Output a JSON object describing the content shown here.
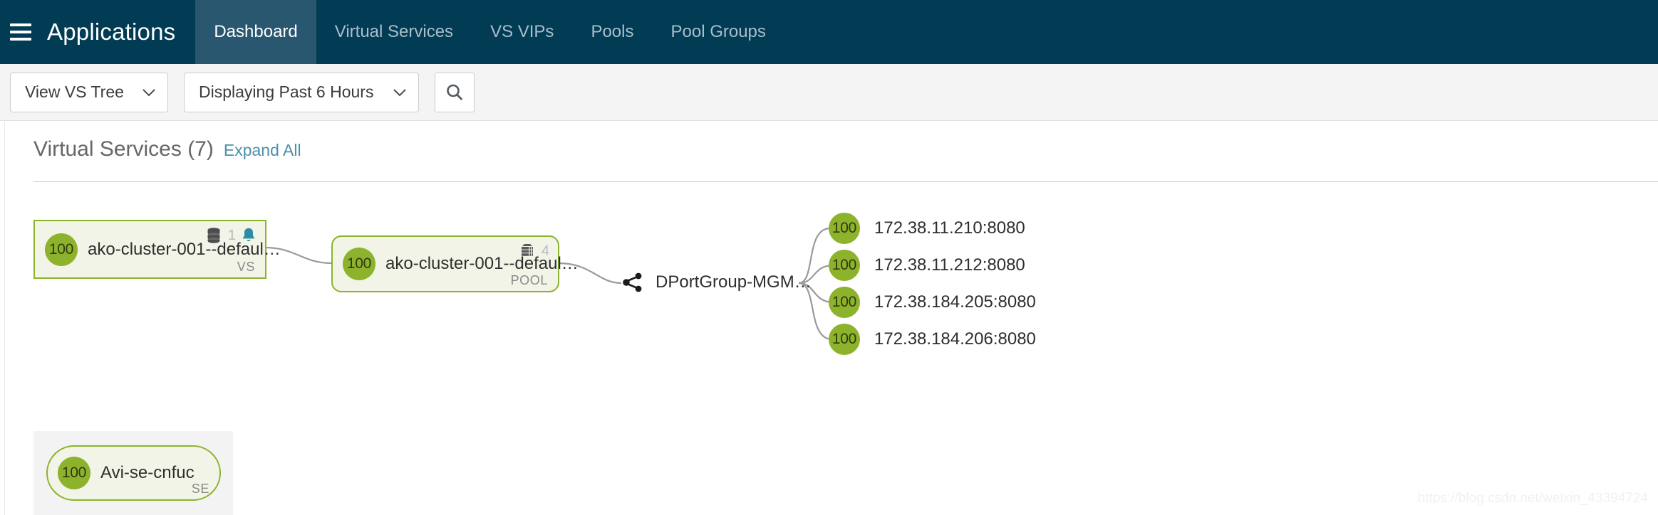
{
  "topnav": {
    "menu_icon": "hamburger-icon",
    "brand": "Applications",
    "tabs": [
      {
        "label": "Dashboard",
        "active": true
      },
      {
        "label": "Virtual Services",
        "active": false
      },
      {
        "label": "VS VIPs",
        "active": false
      },
      {
        "label": "Pools",
        "active": false
      },
      {
        "label": "Pool Groups",
        "active": false
      }
    ]
  },
  "toolbar": {
    "view_select": {
      "value": "View VS Tree",
      "icon": "chevron-down-icon"
    },
    "time_select": {
      "value": "Displaying Past 6 Hours",
      "icon": "chevron-down-icon"
    },
    "search_button": {
      "icon": "search-icon",
      "label": ""
    }
  },
  "panel": {
    "title": "Virtual Services (7)",
    "expand_all": "Expand All"
  },
  "tree": {
    "vs_node": {
      "badge": "100",
      "name": "ako-cluster-001--defaul…",
      "type": "VS",
      "icons": {
        "disks": "database-stack-icon",
        "count": "1",
        "alert": "bell-icon"
      }
    },
    "pool_node": {
      "badge": "100",
      "name": "ako-cluster-001--defaul…",
      "type": "POOL",
      "icons": {
        "servers": "server-rack-icon",
        "count": "4"
      }
    },
    "portgroup_node": {
      "icon": "share-network-icon",
      "name": "DPortGroup-MGM…"
    },
    "servers": [
      {
        "badge": "100",
        "label": "172.38.11.210:8080"
      },
      {
        "badge": "100",
        "label": "172.38.11.212:8080"
      },
      {
        "badge": "100",
        "label": "172.38.184.205:8080"
      },
      {
        "badge": "100",
        "label": "172.38.184.206:8080"
      }
    ],
    "se_node": {
      "badge": "100",
      "name": "Avi-se-cnfuc",
      "type": "SE"
    }
  },
  "watermark": "https://blog.csdn.net/weixin_43394724",
  "colors": {
    "nav_bg": "#023b54",
    "nav_active": "#2a5770",
    "green": "#8db32c",
    "node_fill": "#f1f4e6",
    "link_blue": "#4a90ab",
    "bell_teal": "#2e8ba6",
    "connector": "#9a9a9a"
  }
}
